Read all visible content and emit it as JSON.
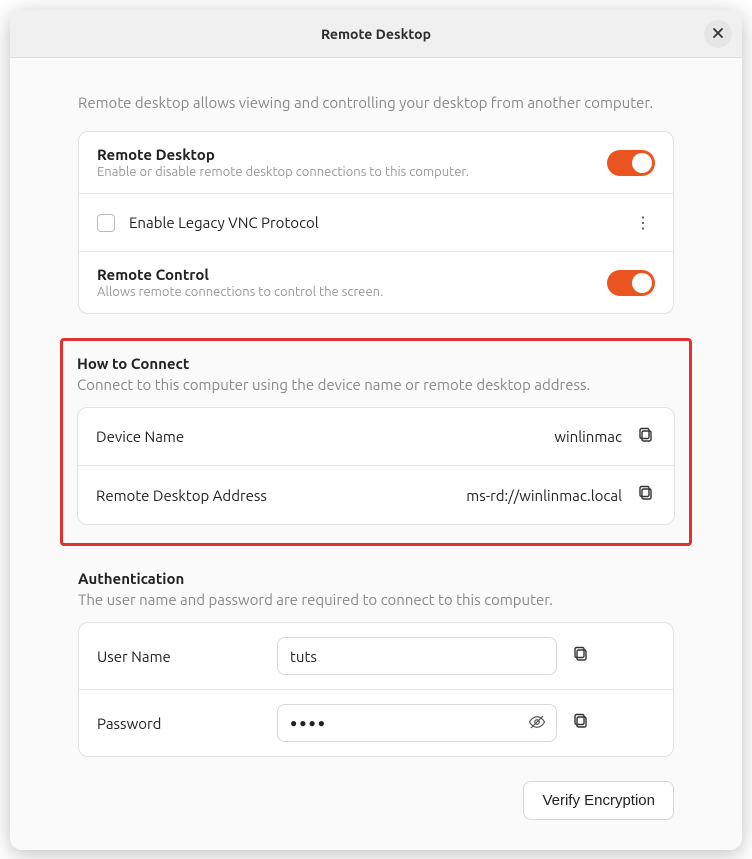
{
  "window": {
    "title": "Remote Desktop"
  },
  "intro": "Remote desktop allows viewing and controlling your desktop from another computer.",
  "settings": {
    "remote_desktop": {
      "title": "Remote Desktop",
      "sub": "Enable or disable remote desktop connections to this computer.",
      "enabled": true
    },
    "vnc": {
      "label": "Enable Legacy VNC Protocol",
      "checked": false
    },
    "remote_control": {
      "title": "Remote Control",
      "sub": "Allows remote connections to control the screen.",
      "enabled": true
    }
  },
  "connect": {
    "heading": "How to Connect",
    "sub": "Connect to this computer using the device name or remote desktop address.",
    "device_name_label": "Device Name",
    "device_name_value": "winlinmac",
    "address_label": "Remote Desktop Address",
    "address_value": "ms-rd://winlinmac.local"
  },
  "auth": {
    "heading": "Authentication",
    "sub": "The user name and password are required to connect to this computer.",
    "username_label": "User Name",
    "username_value": "tuts",
    "password_label": "Password",
    "password_masked": "●●●●"
  },
  "actions": {
    "verify": "Verify Encryption"
  }
}
